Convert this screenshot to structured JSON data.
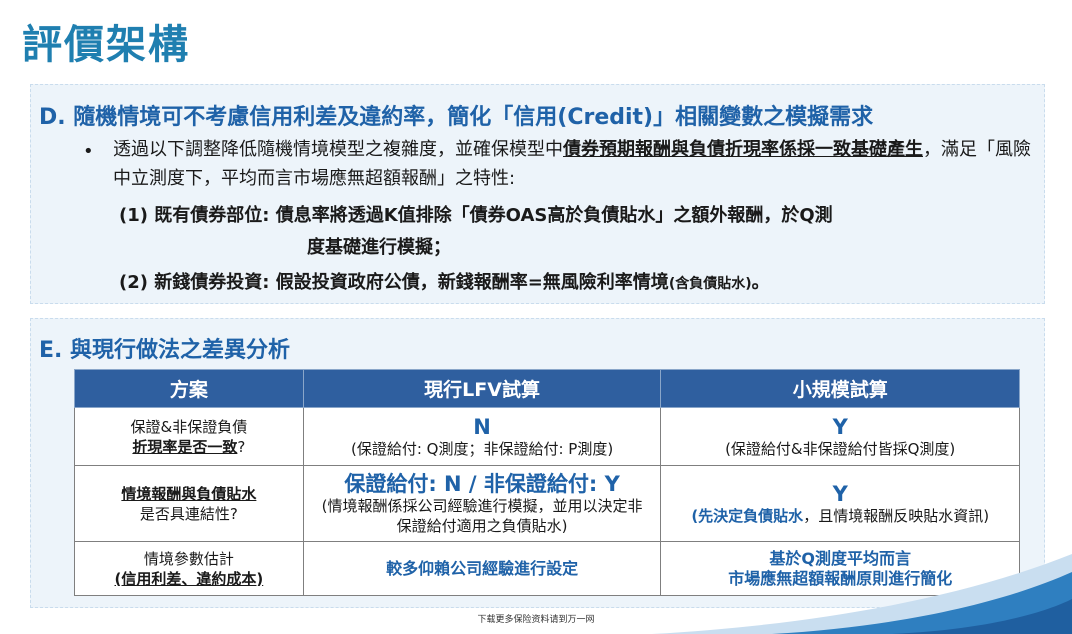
{
  "page_title": "評價架構",
  "section_d": {
    "heading": "D. 隨機情境可不考慮信用利差及違約率，簡化「信用(Credit)」相關變數之模擬需求",
    "bullet": "•",
    "para_prefix": "透過以下調整降低隨機情境模型之複雜度，並確保模型中",
    "para_emphasis": "債券預期報酬與負債折現率係採一致基礎產生",
    "para_suffix": "，滿足「風險中立測度下，平均而言市場應無超額報酬」之特性:",
    "item1_label": "(1) 既有債券部位:",
    "item1_text": " 債息率將透過K值排除「債券OAS高於負債貼水」之額外報酬，於Q測",
    "item1_cont": "度基礎進行模擬；",
    "item2_label": "(2) 新錢債券投資:",
    "item2_text": " 假設投資政府公債，新錢報酬率=無風險利率情境",
    "item2_note": "(含負債貼水)",
    "item2_end": "。"
  },
  "section_e": {
    "heading": "E. 與現行做法之差異分析",
    "table": {
      "headers": [
        "方案",
        "現行LFV試算",
        "小規模試算"
      ],
      "rows": [
        {
          "c1a": "保證&非保證負債",
          "c1b": "折現率是否一致",
          "c1c": "?",
          "c2a": "N",
          "c2b": "(保證給付: Q測度；非保證給付: P測度)",
          "c3a": "Y",
          "c3b": "(保證給付&非保證給付皆採Q測度)"
        },
        {
          "c1a": "情境報酬與負債貼水",
          "c1b": "是否具連結性?",
          "c2a": "保證給付: N / 非保證給付: Y",
          "c2b": "(情境報酬係採公司經驗進行模擬，並用以決定非保證給付適用之負債貼水)",
          "c3a": "Y",
          "c3b": "(先決定負債貼水",
          "c3c": "，且情境報酬反映貼水資訊)"
        },
        {
          "c1a": "情境參數估計",
          "c1b": "(信用利差、違約成本)",
          "c2a": "較多仰賴公司經驗進行設定",
          "c3a": "基於Q測度平均而言",
          "c3b": "市場應無超額報酬原則進行簡化"
        }
      ]
    }
  },
  "footer_text": "下载更多保险资料请到万一网",
  "colors": {
    "title": "#1f7fb0",
    "heading": "#1f62a8",
    "table_header": "#2f5f9f",
    "panel_bg": "#edf4fa"
  }
}
